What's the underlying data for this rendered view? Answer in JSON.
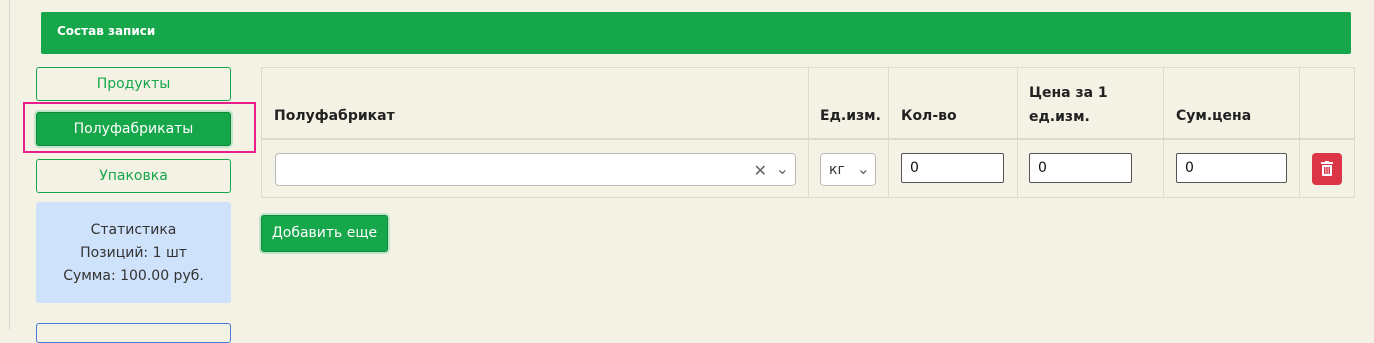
{
  "header": {
    "title": "Состав записи"
  },
  "tabs": [
    {
      "label": "Продукты"
    },
    {
      "label": "Полуфабрикаты"
    },
    {
      "label": "Упаковка"
    }
  ],
  "stats": {
    "title": "Статистика",
    "positions": "Позиций: 1 шт",
    "sum": "Сумма: 100.00 руб."
  },
  "table": {
    "columns": [
      "Полуфабрикат",
      "Ед.изм.",
      "Кол-во",
      "Цена за 1",
      "ед.изм.",
      "Сум.цена"
    ],
    "row": {
      "semi_product": "",
      "unit": "кг",
      "quantity": "0",
      "unit_price": "0",
      "total_price": "0"
    },
    "icons": {
      "clear": "close-icon",
      "dropdown": "chevron-down-icon",
      "delete": "trash-icon"
    }
  },
  "add_button": {
    "label": "Добавить еще"
  },
  "colors": {
    "accent": "#16a74a",
    "danger": "#dc3545",
    "stats_bg": "#cfe2fb",
    "highlight": "#e91e8c"
  }
}
